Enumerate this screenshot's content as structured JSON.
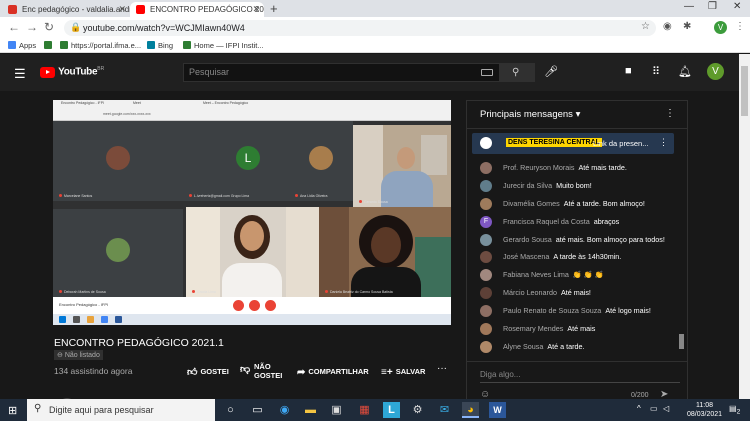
{
  "browser": {
    "tabs": [
      {
        "title": "Enc pedagógico - valdalia.andra",
        "favicon_color": "#d93025"
      },
      {
        "title": "ENCONTRO PEDAGÓGICO 2021",
        "favicon_color": "#ff0000",
        "active": true
      }
    ],
    "new_tab": "+",
    "url": "youtube.com/watch?v=WCJMIawn40W4",
    "bookmarks": [
      {
        "label": "Apps",
        "color": "#4285f4"
      },
      {
        "label": "",
        "color": "#2e7d32"
      },
      {
        "label": "https://portal.ifma.e...",
        "color": "#2e7d32"
      },
      {
        "label": "Bing",
        "color": "#00809d"
      },
      {
        "label": "Home — IFPI Instit...",
        "color": "#2e7d32"
      }
    ],
    "profile_initial": "V"
  },
  "youtube": {
    "logo_text": "YouTube",
    "logo_country": "BR",
    "search_placeholder": "Pesquisar",
    "user_initial": "V"
  },
  "video": {
    "embedded_tabs": [
      "Encontro Pedagógico - IFPI",
      "Meet",
      "Meet – Encontro Pedagógico"
    ],
    "embedded_url": "meet.google.com/xxx-xxxx-xxx",
    "participants": [
      {
        "name": "Marcelane Santos",
        "avatar_color": "#7b4b3a"
      },
      {
        "name": "L.ivrehertz@gmail.com Grupo Lima",
        "initial": "L"
      },
      {
        "name": "Ana Lidia Oliveira",
        "avatar_color": "#a87d4c"
      },
      {
        "name": "Deborah Martins de Sousa",
        "avatar_color": "#6b8e4e"
      },
      {
        "name": "Gracia Lima"
      },
      {
        "name": "Gerardo Sousa"
      },
      {
        "name": "Daniela Beatriz do Carmo Sousa Batista"
      }
    ],
    "meeting_title": "Encontro Pedagógico - IFPI",
    "title": "ENCONTRO PEDAGÓGICO 2021.1",
    "unlisted_label": "Não listado",
    "views": "134 assistindo agora",
    "actions": {
      "like": "GOSTEI",
      "dislike_line1": "NÃO",
      "dislike_line2": "GOSTEI",
      "share": "COMPARTILHAR",
      "save": "SALVAR",
      "more": "···"
    }
  },
  "chat": {
    "header": "Principais mensagens",
    "header_caret": "▾",
    "pinned": {
      "author": "DENS TERESINA CENTRAL",
      "text": "Link da presen..."
    },
    "messages": [
      {
        "author": "Prof. Reuryson Morais",
        "text": "Até mais tarde.",
        "avatar_color": "#8d6e63",
        "initial": ""
      },
      {
        "author": "Jurecir da Silva",
        "text": "Muito bom!",
        "avatar_color": "#607d8b",
        "initial": ""
      },
      {
        "author": "Divamélia Gomes",
        "text": "Até a tarde. Bom almoço!",
        "avatar_color": "#9e7b5c",
        "initial": ""
      },
      {
        "author": "Francisca Raquel da Costa",
        "text": "abraços",
        "avatar_color": "#7e57c2",
        "initial": "F"
      },
      {
        "author": "Gerardo Sousa",
        "text": "até mais. Bom almoço para todos!",
        "avatar_color": "#78909c",
        "initial": ""
      },
      {
        "author": "José Mascena",
        "text": "A tarde às 14h30min.",
        "avatar_color": "#6d4c41",
        "initial": ""
      },
      {
        "author": "Fabiana Neves Lima",
        "text": "👏 👏 👏",
        "avatar_color": "#a1887f",
        "initial": ""
      },
      {
        "author": "Márcio Leonardo",
        "text": "Até mais!",
        "avatar_color": "#5d4037",
        "initial": ""
      },
      {
        "author": "Paulo Renato de Souza Souza",
        "text": "Até logo mais!",
        "avatar_color": "#8d6e63",
        "initial": ""
      },
      {
        "author": "Rosemary Mendes",
        "text": "Até mais",
        "avatar_color": "#a0785a",
        "initial": ""
      },
      {
        "author": "Alyne Sousa",
        "text": "Até a tarde.",
        "avatar_color": "#b08968",
        "initial": ""
      }
    ],
    "input_placeholder": "Diga algo...",
    "char_count": "0/200"
  },
  "taskbar": {
    "search_placeholder": "Digite aqui para pesquisar",
    "time": "11:08",
    "date": "08/03/2021",
    "notification_count": "2"
  }
}
